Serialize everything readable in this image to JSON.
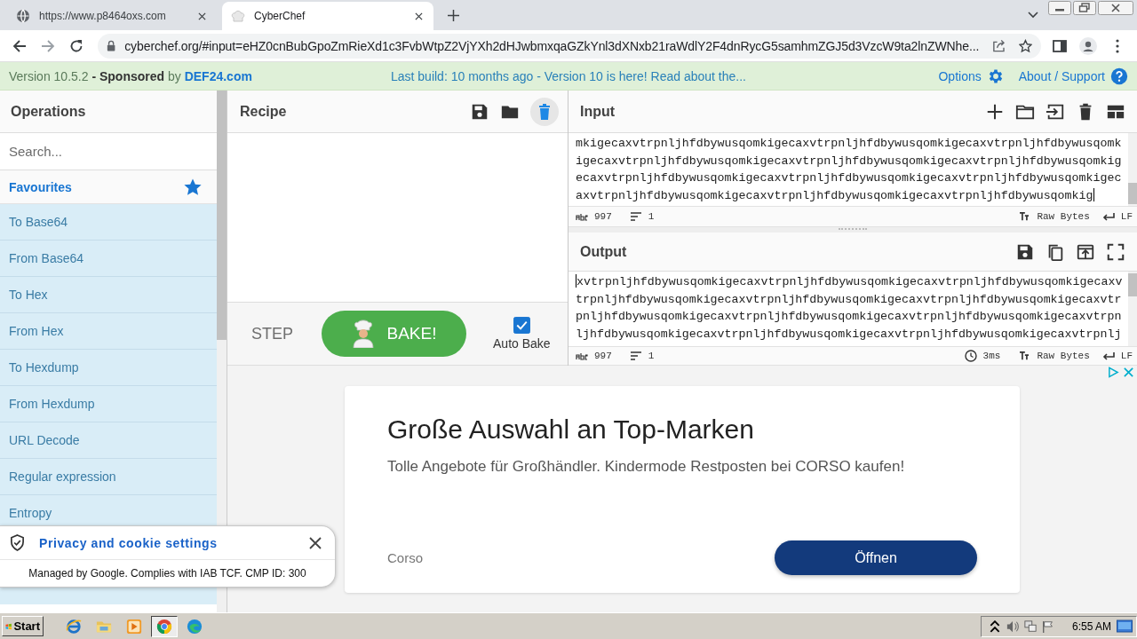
{
  "browser": {
    "tabs": [
      {
        "title": "https://www.p8464oxs.com",
        "selected": false
      },
      {
        "title": "CyberChef",
        "selected": true
      }
    ],
    "url": "cyberchef.org/#input=eHZ0cnBubGpoZmRieXd1c3FvbWtpZ2VjYXh2dHJwbmxqaGZkYnl3dXNxb21raWdlY2F4dnRycG5samhmZGJ5d3VzcW9ta2lnZWNhe..."
  },
  "banner": {
    "version": "Version 10.5.2 **- Sponsored** by",
    "sponsor": "DEF24.com",
    "notice": "Last build: 10 months ago - Version 10 is here! Read about the...",
    "options": "Options",
    "support": "About / Support"
  },
  "operations": {
    "title": "Operations",
    "search": {
      "placeholder": "Search..."
    },
    "favourites": "Favourites",
    "items": [
      "To Base64",
      "From Base64",
      "To Hex",
      "From Hex",
      "To Hexdump",
      "From Hexdump",
      "URL Decode",
      "Regular expression",
      "Entropy"
    ]
  },
  "recipe": {
    "title": "Recipe",
    "step": "STEP",
    "bake": "BAKE!",
    "auto_bake": {
      "label": "Auto Bake",
      "checked": true
    }
  },
  "input": {
    "title": "Input",
    "lines": [
      "mkigecaxvtrpnljhfdbywusqomkigecaxvtrpnljhfdbywusqomkigecaxvtrpnljhfdbywusqomk",
      "igecaxvtrpnljhfdbywusqomkigecaxvtrpnljhfdbywusqomkigecaxvtrpnljhfdbywusqomkig",
      "ecaxvtrpnljhfdbywusqomkigecaxvtrpnljhfdbywusqomkigecaxvtrpnljhfdbywusqomkigec",
      "axvtrpnljhfdbywusqomkigecaxvtrpnljhfdbywusqomkigecaxvtrpnljhfdbywusqomkig"
    ],
    "status": {
      "length": "997",
      "lines": "1",
      "format": "Raw Bytes",
      "eol": "LF"
    }
  },
  "output": {
    "title": "Output",
    "lines": [
      "xvtrpnljhfdbywusqomkigecaxvtrpnljhfdbywusqomkigecaxvtrpnljhfdbywusqomkigecaxv",
      "trpnljhfdbywusqomkigecaxvtrpnljhfdbywusqomkigecaxvtrpnljhfdbywusqomkigecaxvtr",
      "pnljhfdbywusqomkigecaxvtrpnljhfdbywusqomkigecaxvtrpnljhfdbywusqomkigecaxvtrpn",
      "ljhfdbywusqomkigecaxvtrpnljhfdbywusqomkigecaxvtrpnljhfdbywusqomkigecaxvtrpnlj"
    ],
    "status": {
      "length": "997",
      "lines": "1",
      "time": "3ms",
      "format": "Raw Bytes",
      "eol": "LF"
    }
  },
  "ad": {
    "title": "Große Auswahl an Top-Marken",
    "text": "Tolle Angebote für Großhändler. Kindermode Restposten bei CORSO kaufen!",
    "advertiser": "Corso",
    "button": "Öffnen"
  },
  "cookie_banner": {
    "title": "Privacy and cookie settings",
    "text": "Managed by Google. Complies with IAB TCF. CMP ID: 300"
  },
  "taskbar": {
    "start": "Start",
    "apps": [
      {
        "selected": false
      },
      {
        "selected": false
      },
      {
        "selected": false
      },
      {
        "selected": true
      },
      {
        "selected": false
      }
    ],
    "clock": "6:55 AM"
  }
}
